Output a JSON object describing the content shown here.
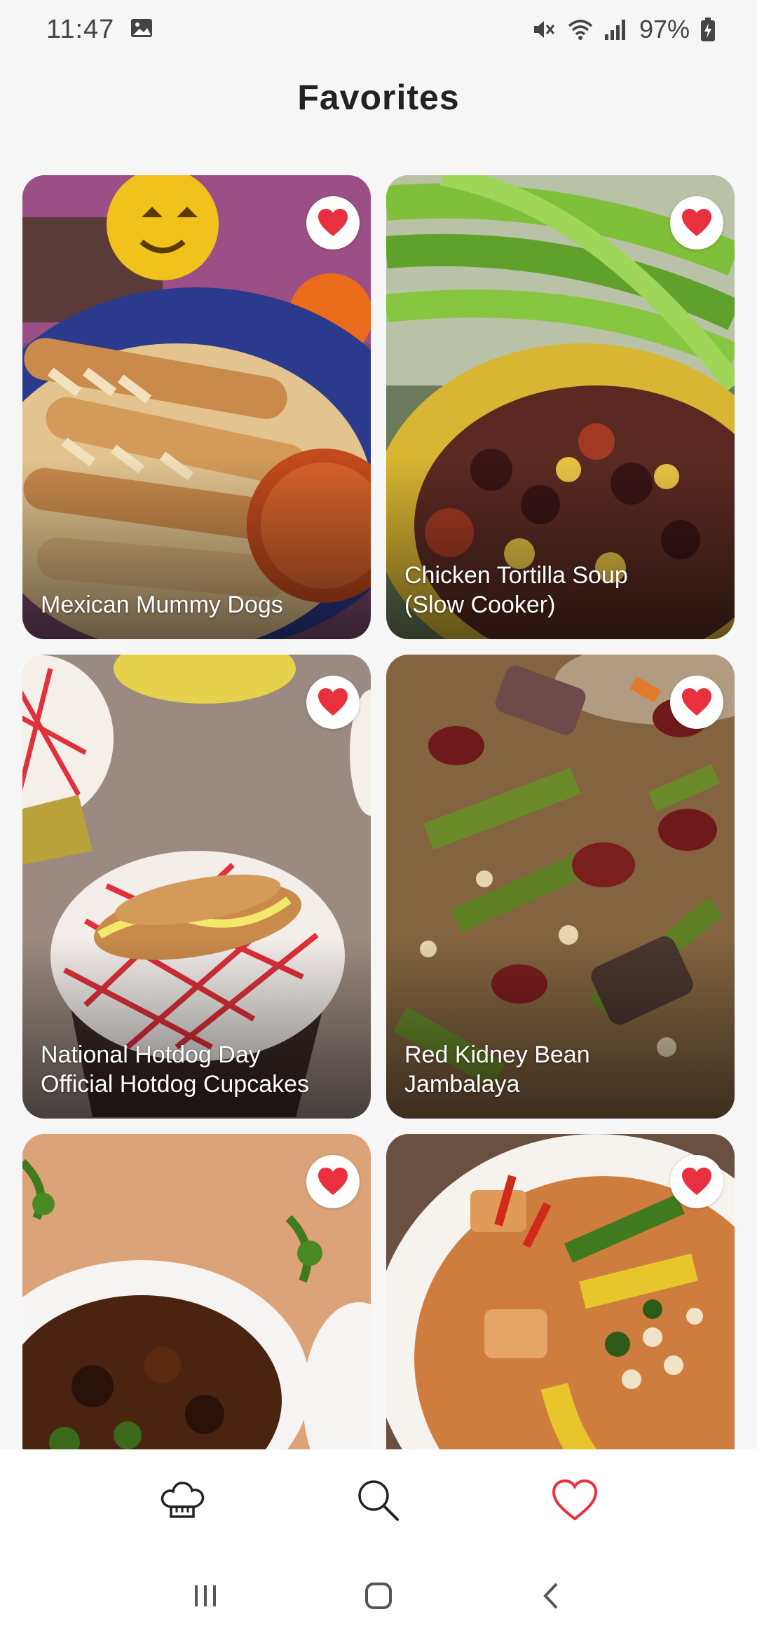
{
  "status_bar": {
    "time": "11:47",
    "battery": "97%"
  },
  "page": {
    "title": "Favorites"
  },
  "recipes": [
    {
      "name": "Mexican Mummy Dogs",
      "favorited": true
    },
    {
      "name": "Chicken Tortilla Soup\n(Slow Cooker)",
      "favorited": true
    },
    {
      "name": "National Hotdog Day\nOfficial Hotdog Cupcakes",
      "favorited": true
    },
    {
      "name": "Red Kidney Bean\nJambalaya",
      "favorited": true
    },
    {
      "name": "",
      "favorited": true
    },
    {
      "name": "",
      "favorited": true
    }
  ],
  "bottom_nav": {
    "items": [
      {
        "icon": "chef-hat-icon",
        "active": false
      },
      {
        "icon": "search-icon",
        "active": false
      },
      {
        "icon": "heart-icon",
        "active": true
      }
    ]
  },
  "colors": {
    "accent": "#e8303f",
    "background": "#f6f6f6"
  }
}
